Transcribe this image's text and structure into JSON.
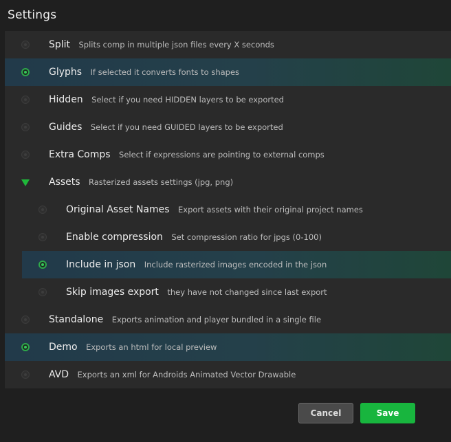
{
  "title": "Settings",
  "options": [
    {
      "name": "Split",
      "desc": "Splits comp in multiple json files every X seconds",
      "selected": false
    },
    {
      "name": "Glyphs",
      "desc": "If selected it converts fonts to shapes",
      "selected": true
    },
    {
      "name": "Hidden",
      "desc": "Select if you need HIDDEN layers to be exported",
      "selected": false
    },
    {
      "name": "Guides",
      "desc": "Select if you need GUIDED layers to be exported",
      "selected": false
    },
    {
      "name": "Extra Comps",
      "desc": "Select if expressions are pointing to external comps",
      "selected": false
    },
    {
      "name": "Assets",
      "desc": "Rasterized assets settings (jpg, png)",
      "expanded": true
    },
    {
      "name": "Original Asset Names",
      "desc": "Export assets with their original project names",
      "selected": false
    },
    {
      "name": "Enable compression",
      "desc": "Set compression ratio for jpgs (0-100)",
      "selected": false
    },
    {
      "name": "Include in json",
      "desc": "Include rasterized images encoded in the json",
      "selected": true
    },
    {
      "name": "Skip images export",
      "desc": "they have not changed since last export",
      "selected": false
    },
    {
      "name": "Standalone",
      "desc": "Exports animation and player bundled in a single file",
      "selected": false
    },
    {
      "name": "Demo",
      "desc": "Exports an html for local preview",
      "selected": true
    },
    {
      "name": "AVD",
      "desc": "Exports an xml for Androids Animated Vector Drawable",
      "selected": false
    }
  ],
  "buttons": {
    "cancel": "Cancel",
    "save": "Save"
  },
  "colors": {
    "accent": "#18b53e",
    "selected_row_start": "#223a4a",
    "selected_row_end": "#1f4638"
  }
}
